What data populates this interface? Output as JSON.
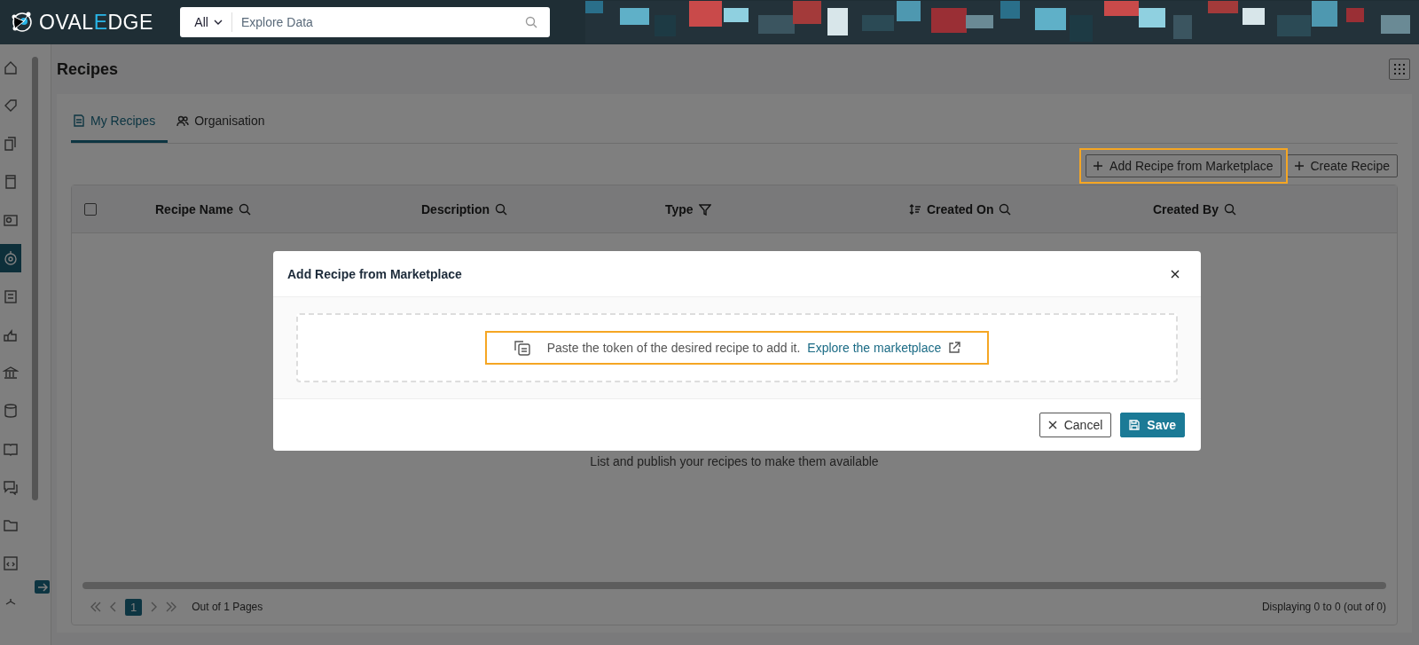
{
  "top_bar": {
    "logo_parts": [
      "OVAL",
      "E",
      "DGE"
    ],
    "search": {
      "scope": "All",
      "placeholder": "Explore Data"
    }
  },
  "sidebar": {
    "items": [
      {
        "selected": false
      },
      {
        "selected": false
      },
      {
        "selected": false
      },
      {
        "selected": false
      },
      {
        "selected": false
      },
      {
        "selected": true
      },
      {
        "selected": false
      },
      {
        "selected": false
      },
      {
        "selected": false
      },
      {
        "selected": false
      },
      {
        "selected": false
      },
      {
        "selected": false
      },
      {
        "selected": false
      },
      {
        "selected": false
      },
      {
        "selected": false
      }
    ]
  },
  "page": {
    "title": "Recipes"
  },
  "tabs": [
    {
      "label": "My Recipes",
      "selected": true
    },
    {
      "label": "Organisation",
      "selected": false
    }
  ],
  "actions": [
    {
      "label": "Add Recipe from Marketplace",
      "highlighted": true
    },
    {
      "label": "Create Recipe",
      "highlighted": false
    }
  ],
  "table": {
    "select_all": {
      "checked": false
    },
    "columns": [
      {
        "label": "Recipe Name",
        "kind": "search"
      },
      {
        "label": "Description",
        "kind": "search"
      },
      {
        "label": "Type",
        "kind": "filter"
      },
      {
        "label": "Created On",
        "kind": "sort-search"
      },
      {
        "label": "Created By",
        "kind": "search"
      }
    ],
    "empty_message": "List and publish your recipes to make them available"
  },
  "pagination": {
    "current_page": "1",
    "summary": "Out of 1 Pages",
    "displaying": "Displaying 0 to 0 (out of 0)"
  },
  "modal": {
    "title": "Add Recipe from Marketplace",
    "hint": "Paste the token of the desired recipe to add it.",
    "link": "Explore the marketplace",
    "highlighted": true,
    "buttons": [
      {
        "label": "Cancel",
        "kind": "secondary"
      },
      {
        "label": "Save",
        "kind": "primary"
      }
    ]
  }
}
